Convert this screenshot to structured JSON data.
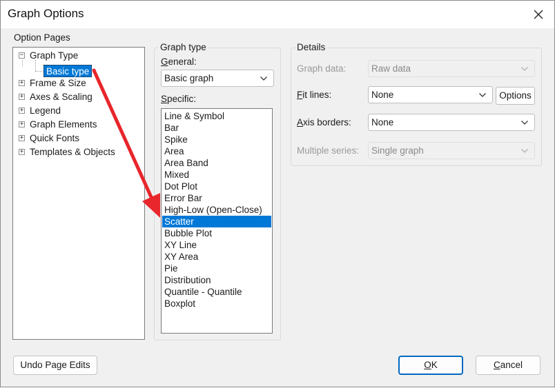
{
  "window": {
    "title": "Graph Options"
  },
  "colors": {
    "selection": "#0078d7",
    "annotation_arrow": "#e8262b"
  },
  "option_pages": {
    "label": "Option Pages",
    "items": [
      {
        "label": "Graph Type",
        "expander": "−"
      },
      {
        "label": "Basic type"
      },
      {
        "label": "Frame & Size",
        "expander": "+"
      },
      {
        "label": "Axes & Scaling",
        "expander": "+"
      },
      {
        "label": "Legend",
        "expander": "+"
      },
      {
        "label": "Graph Elements",
        "expander": "+"
      },
      {
        "label": "Quick Fonts",
        "expander": "+"
      },
      {
        "label": "Templates & Objects",
        "expander": "+"
      }
    ],
    "selected": "Basic type"
  },
  "graph_type": {
    "label": "Graph type",
    "general_label": "General:",
    "general_value": "Basic graph",
    "specific_label": "Specific:",
    "specific_items": [
      "Line & Symbol",
      "Bar",
      "Spike",
      "Area",
      "Area Band",
      "Mixed",
      "Dot Plot",
      "Error Bar",
      "High-Low (Open-Close)",
      "Scatter",
      "Bubble Plot",
      "XY Line",
      "XY Area",
      "Pie",
      "Distribution",
      "Quantile - Quantile",
      "Boxplot"
    ],
    "selected": "Scatter"
  },
  "details": {
    "label": "Details",
    "graph_data_label": "Graph data:",
    "graph_data_value": "Raw data",
    "fit_lines_label": "Fit lines:",
    "fit_lines_value": "None",
    "options_button": "Options",
    "axis_borders_label": "Axis borders:",
    "axis_borders_value": "None",
    "multiple_series_label": "Multiple series:",
    "multiple_series_value": "Single graph"
  },
  "buttons": {
    "undo": "Undo Page Edits",
    "ok": "OK",
    "cancel": "Cancel"
  }
}
